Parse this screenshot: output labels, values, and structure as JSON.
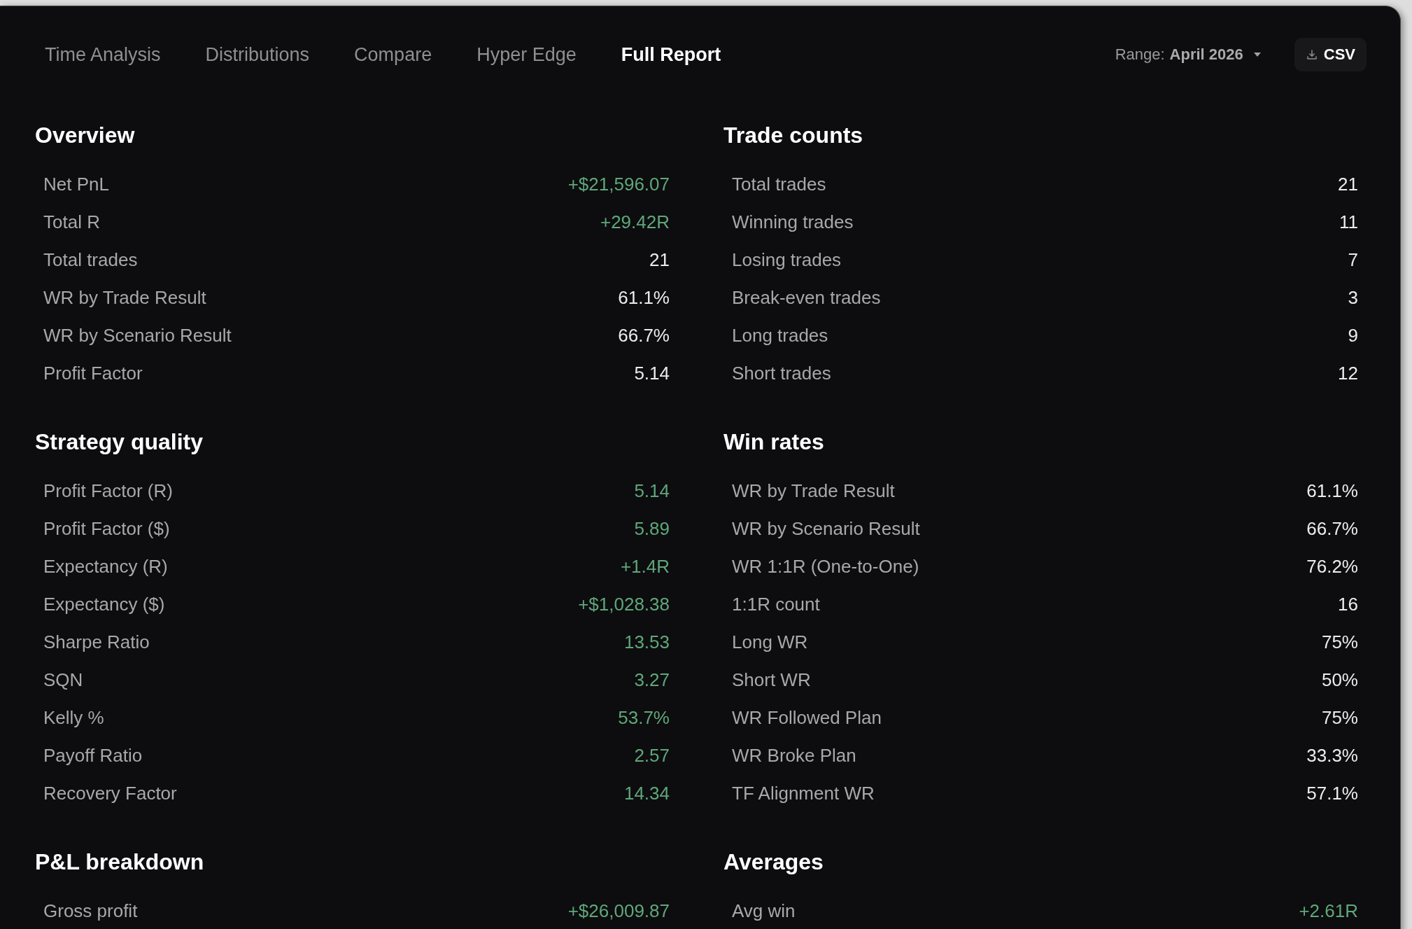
{
  "tabs": [
    {
      "label": "Time Analysis",
      "selected": false
    },
    {
      "label": "Distributions",
      "selected": false
    },
    {
      "label": "Compare",
      "selected": false
    },
    {
      "label": "Hyper Edge",
      "selected": false
    },
    {
      "label": "Full Report",
      "selected": true
    }
  ],
  "range": {
    "label": "Range:",
    "value": "April 2026"
  },
  "export_button": {
    "label": "CSV"
  },
  "sections": [
    {
      "title": "Overview",
      "rows": [
        {
          "label": "Net PnL",
          "value": "+$21,596.07",
          "positive": true
        },
        {
          "label": "Total R",
          "value": "+29.42R",
          "positive": true
        },
        {
          "label": "Total trades",
          "value": "21",
          "positive": false
        },
        {
          "label": "WR by Trade Result",
          "value": "61.1%",
          "positive": false
        },
        {
          "label": "WR by Scenario Result",
          "value": "66.7%",
          "positive": false
        },
        {
          "label": "Profit Factor",
          "value": "5.14",
          "positive": false
        }
      ]
    },
    {
      "title": "Trade counts",
      "rows": [
        {
          "label": "Total trades",
          "value": "21",
          "positive": false
        },
        {
          "label": "Winning trades",
          "value": "11",
          "positive": false
        },
        {
          "label": "Losing trades",
          "value": "7",
          "positive": false
        },
        {
          "label": "Break-even trades",
          "value": "3",
          "positive": false
        },
        {
          "label": "Long trades",
          "value": "9",
          "positive": false
        },
        {
          "label": "Short trades",
          "value": "12",
          "positive": false
        }
      ]
    },
    {
      "title": "Strategy quality",
      "rows": [
        {
          "label": "Profit Factor (R)",
          "value": "5.14",
          "positive": true
        },
        {
          "label": "Profit Factor ($)",
          "value": "5.89",
          "positive": true
        },
        {
          "label": "Expectancy (R)",
          "value": "+1.4R",
          "positive": true
        },
        {
          "label": "Expectancy ($)",
          "value": "+$1,028.38",
          "positive": true
        },
        {
          "label": "Sharpe Ratio",
          "value": "13.53",
          "positive": true
        },
        {
          "label": "SQN",
          "value": "3.27",
          "positive": true
        },
        {
          "label": "Kelly %",
          "value": "53.7%",
          "positive": true
        },
        {
          "label": "Payoff Ratio",
          "value": "2.57",
          "positive": true
        },
        {
          "label": "Recovery Factor",
          "value": "14.34",
          "positive": true
        }
      ]
    },
    {
      "title": "Win rates",
      "rows": [
        {
          "label": "WR by Trade Result",
          "value": "61.1%",
          "positive": false
        },
        {
          "label": "WR by Scenario Result",
          "value": "66.7%",
          "positive": false
        },
        {
          "label": "WR 1:1R (One-to-One)",
          "value": "76.2%",
          "positive": false
        },
        {
          "label": "1:1R count",
          "value": "16",
          "positive": false
        },
        {
          "label": "Long WR",
          "value": "75%",
          "positive": false
        },
        {
          "label": "Short WR",
          "value": "50%",
          "positive": false
        },
        {
          "label": "WR Followed Plan",
          "value": "75%",
          "positive": false
        },
        {
          "label": "WR Broke Plan",
          "value": "33.3%",
          "positive": false
        },
        {
          "label": "TF Alignment WR",
          "value": "57.1%",
          "positive": false
        }
      ]
    },
    {
      "title": "P&L breakdown",
      "rows": [
        {
          "label": "Gross profit",
          "value": "+$26,009.87",
          "positive": true
        }
      ]
    },
    {
      "title": "Averages",
      "rows": [
        {
          "label": "Avg win",
          "value": "+2.61R",
          "positive": true
        }
      ]
    }
  ]
}
